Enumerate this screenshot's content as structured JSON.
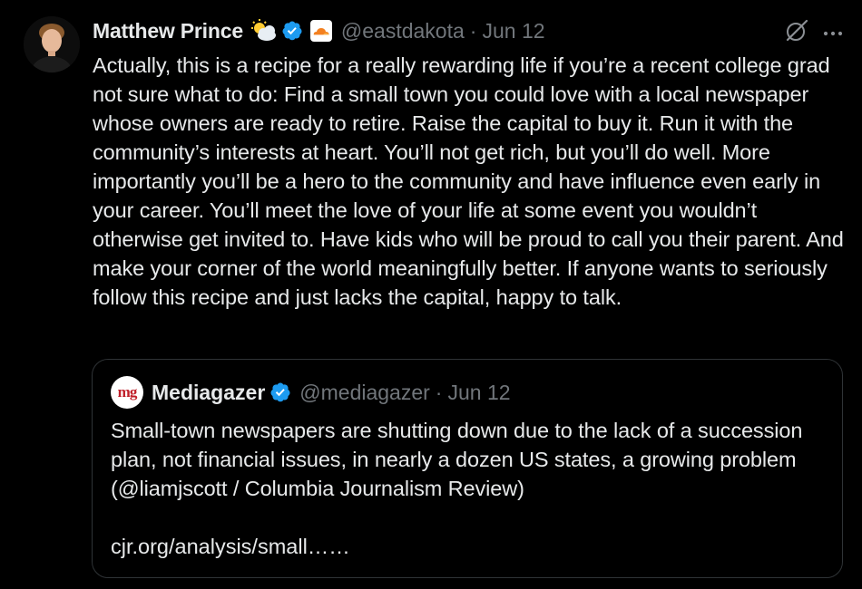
{
  "tweet": {
    "author_name": "Matthew Prince",
    "author_emoji": "⛅",
    "handle": "@eastdakota",
    "separator": "·",
    "date": "Jun 12",
    "text": "Actually, this is a recipe for a really rewarding life if you’re a recent college grad not sure what to do: Find a small town you could love with a local newspaper whose owners are ready to retire. Raise the capital to buy it. Run it with the community’s interests at heart. You’ll not get rich, but you’ll do well. More importantly you’ll be a hero to the community and have influence even early in your career. You’ll meet the love of your life at some event you wouldn’t otherwise get invited to. Have kids who will be proud to call you their parent. And make your corner of the world meaningfully better. If anyone wants to seriously follow this recipe and just lacks the capital, happy to talk.",
    "icons": {
      "verified": "verified-badge-icon",
      "affiliation": "cloudflare-logo-icon",
      "grok": "grok-icon",
      "more": "more-options-icon"
    }
  },
  "quoted_tweet": {
    "avatar_text": "mg",
    "author_name": "Mediagazer",
    "handle": "@mediagazer",
    "separator": "·",
    "date": "Jun 12",
    "text": "Small-town newspapers are shutting down due to the lack of a succession plan, not financial issues, in nearly a dozen US states, a growing problem (@liamjscott / Columbia Journalism Review)",
    "link": "cjr.org/analysis/small……"
  },
  "colors": {
    "background": "#000000",
    "text": "#e7e9ea",
    "muted": "#71767b",
    "border": "#2f3336",
    "verified": "#1d9bf0",
    "cloudflare": "#f38020"
  }
}
